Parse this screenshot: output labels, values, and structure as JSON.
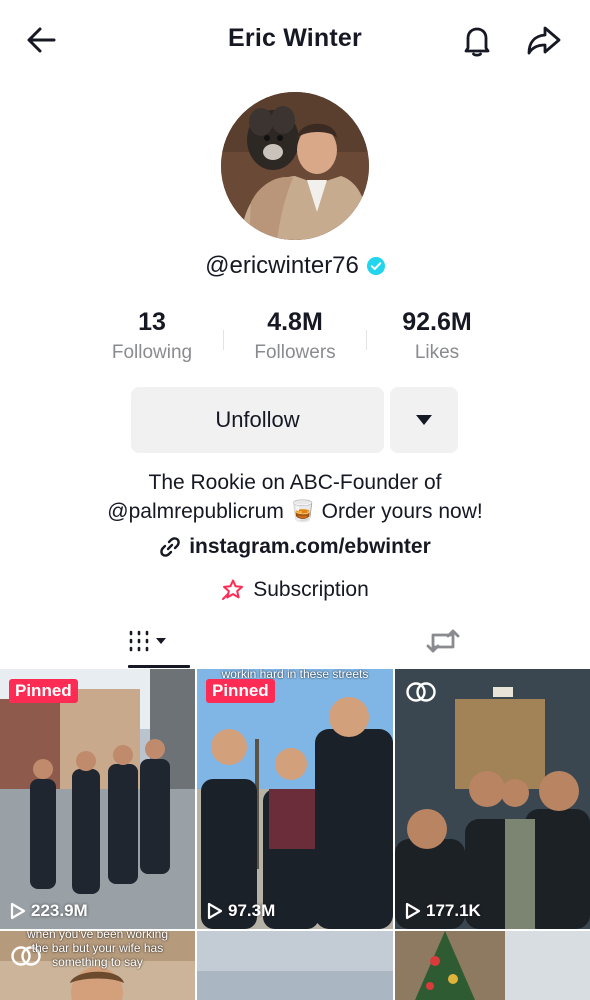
{
  "header": {
    "title": "Eric Winter",
    "back_icon": "arrow-left-icon",
    "bell_icon": "bell-icon",
    "share_icon": "share-arrow-icon"
  },
  "profile": {
    "handle": "@ericwinter76",
    "verified": true,
    "verified_color": "#20d5ec"
  },
  "stats": [
    {
      "value": "13",
      "label": "Following"
    },
    {
      "value": "4.8M",
      "label": "Followers"
    },
    {
      "value": "92.6M",
      "label": "Likes"
    }
  ],
  "actions": {
    "unfollow_label": "Unfollow",
    "more_icon": "caret-down-icon"
  },
  "bio": {
    "line1": "The Rookie on ABC-Founder of",
    "line2_mention": "@palmrepublicrum",
    "line2_emoji": "🥃",
    "line2_rest": "Order yours now!",
    "link_icon": "link-icon",
    "link": "instagram.com/ebwinter",
    "subscription_icon": "subscription-star-icon",
    "subscription_label": "Subscription",
    "subscription_color": "#fe2c55"
  },
  "tabs": [
    {
      "name": "videos",
      "icon": "grid-lines-icon",
      "active": true
    },
    {
      "name": "reposts",
      "icon": "repost-icon",
      "active": false
    }
  ],
  "videos": [
    {
      "pinned": true,
      "pinned_label": "Pinned",
      "views": "223.9M"
    },
    {
      "pinned": true,
      "pinned_label": "Pinned",
      "views": "97.3M",
      "caption": "workin hard in these streets"
    },
    {
      "pinned": false,
      "views": "177.1K",
      "multi": true
    },
    {
      "pinned": false,
      "caption": "when you've been working the bar but your wife has something to say",
      "multi": true
    },
    {
      "pinned": false
    },
    {
      "pinned": false
    }
  ],
  "colors": {
    "accent": "#fe2c55",
    "text": "#161823",
    "muted": "#8a8b91",
    "button_bg": "#f1f1f2"
  }
}
